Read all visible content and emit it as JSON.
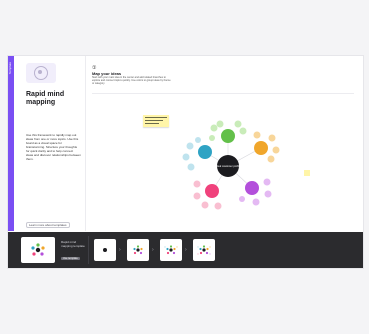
{
  "sidebar": {
    "rail_label": "Template",
    "title": "Rapid mind mapping",
    "description": "Use this framework to rapidly map out ideas from one or more topics. Use this board as a visual space for brainstorming. Structure your thoughts for quick clarity and to help connect ideas and discover relationships between them.",
    "link_label": "Learn more about templates"
  },
  "canvas": {
    "step_icon": "①",
    "title": "Map your ideas",
    "subtitle": "Start with your main idea in the center and add related branches to explore and connect topics quickly. Use colors to group ideas by theme or category.",
    "center_node": "Ideal customer profile"
  },
  "bottom_bar": {
    "info_text": "Rapid mind mapping template",
    "info_button": "Use template"
  },
  "colors": {
    "accent": "#7a4ff3",
    "center": "#1b1b1f",
    "green": "#63c04a",
    "orange": "#f0a62b",
    "purple": "#b34fdb",
    "pink": "#f0427c",
    "blue": "#2fa3c4"
  }
}
